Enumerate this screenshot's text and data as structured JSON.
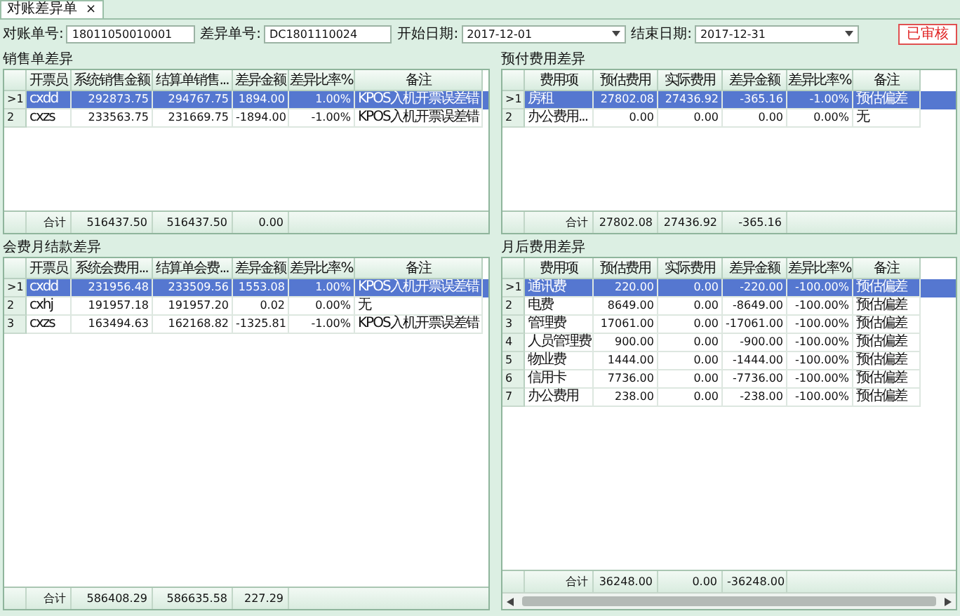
{
  "tab": {
    "label": "对账差异单",
    "close": "×"
  },
  "filters": [
    {
      "label": "对账单号:",
      "value": "18011050010001",
      "kind": "text"
    },
    {
      "label": "差异单号:",
      "value": "DC1801110024",
      "kind": "text"
    },
    {
      "label": "开始日期:",
      "value": "2017-12-01",
      "kind": "date"
    },
    {
      "label": "结束日期:",
      "value": "2017-12-31",
      "kind": "date"
    }
  ],
  "status_button": "已审核",
  "left": [
    {
      "title": "销售单差异",
      "columns": [
        {
          "label": "开票员",
          "kind": "text"
        },
        {
          "label": "系统销售金额",
          "kind": "number"
        },
        {
          "label": "结算单销售...",
          "kind": "number"
        },
        {
          "label": "差异金额",
          "kind": "number"
        },
        {
          "label": "差异比率%",
          "kind": "number"
        },
        {
          "label": "备注",
          "kind": "text"
        }
      ],
      "rows": [
        {
          "header": ">1",
          "selected": true,
          "cells": [
            "cxdd",
            "292873.75",
            "294767.75",
            "1894.00",
            "1.00%",
            "KPOS入机开票误差错"
          ]
        },
        {
          "header": "2",
          "selected": false,
          "cells": [
            "cxzs",
            "233563.75",
            "231669.75",
            "-1894.00",
            "-1.00%",
            "KPOS入机开票误差错"
          ]
        }
      ],
      "total": {
        "label": "合计",
        "values": [
          "516437.50",
          "516437.50",
          "0.00"
        ]
      }
    },
    {
      "title": "会费月结款差异",
      "columns": [
        {
          "label": "开票员",
          "kind": "text"
        },
        {
          "label": "系统会费用...",
          "kind": "number"
        },
        {
          "label": "结算单会费...",
          "kind": "number"
        },
        {
          "label": "差异金额",
          "kind": "number"
        },
        {
          "label": "差异比率%",
          "kind": "number"
        },
        {
          "label": "备注",
          "kind": "text"
        }
      ],
      "rows": [
        {
          "header": ">1",
          "selected": true,
          "cells": [
            "cxdd",
            "231956.48",
            "233509.56",
            "1553.08",
            "1.00%",
            "KPOS入机开票误差错"
          ]
        },
        {
          "header": "2",
          "selected": false,
          "cells": [
            "cxhj",
            "191957.18",
            "191957.20",
            "0.02",
            "0.00%",
            "无"
          ]
        },
        {
          "header": "3",
          "selected": false,
          "cells": [
            "cxzs",
            "163494.63",
            "162168.82",
            "-1325.81",
            "-1.00%",
            "KPOS入机开票误差错"
          ]
        }
      ],
      "total": {
        "label": "合计",
        "values": [
          "586408.29",
          "586635.58",
          "227.29"
        ]
      }
    }
  ],
  "right": [
    {
      "title": "预付费用差异",
      "columns": [
        {
          "label": "费用项",
          "kind": "text"
        },
        {
          "label": "预估费用",
          "kind": "number"
        },
        {
          "label": "实际费用",
          "kind": "number"
        },
        {
          "label": "差异金额",
          "kind": "number"
        },
        {
          "label": "差异比率%",
          "kind": "number"
        },
        {
          "label": "备注",
          "kind": "text"
        }
      ],
      "rows": [
        {
          "header": ">1",
          "selected": true,
          "cells": [
            "房租",
            "27802.08",
            "27436.92",
            "-365.16",
            "-1.00%",
            "预估偏差"
          ]
        },
        {
          "header": "2",
          "selected": false,
          "cells": [
            "办公费用...",
            "0.00",
            "0.00",
            "0.00",
            "0.00%",
            "无"
          ]
        }
      ],
      "total": {
        "label": "合计",
        "values": [
          "27802.08",
          "27436.92",
          "-365.16"
        ]
      }
    },
    {
      "title": "月后费用差异",
      "columns": [
        {
          "label": "费用项",
          "kind": "text"
        },
        {
          "label": "预估费用",
          "kind": "number"
        },
        {
          "label": "实际费用",
          "kind": "number"
        },
        {
          "label": "差异金额",
          "kind": "number"
        },
        {
          "label": "差异比率%",
          "kind": "number"
        },
        {
          "label": "备注",
          "kind": "text"
        }
      ],
      "rows": [
        {
          "header": ">1",
          "selected": true,
          "cells": [
            "通讯费",
            "220.00",
            "0.00",
            "-220.00",
            "-100.00%",
            "预估偏差"
          ]
        },
        {
          "header": "2",
          "selected": false,
          "cells": [
            "电费",
            "8649.00",
            "0.00",
            "-8649.00",
            "-100.00%",
            "预估偏差"
          ]
        },
        {
          "header": "3",
          "selected": false,
          "cells": [
            "管理费",
            "17061.00",
            "0.00",
            "-17061.00",
            "-100.00%",
            "预估偏差"
          ]
        },
        {
          "header": "4",
          "selected": false,
          "cells": [
            "人员管理费",
            "900.00",
            "0.00",
            "-900.00",
            "-100.00%",
            "预估偏差"
          ]
        },
        {
          "header": "5",
          "selected": false,
          "cells": [
            "物业费",
            "1444.00",
            "0.00",
            "-1444.00",
            "-100.00%",
            "预估偏差"
          ]
        },
        {
          "header": "6",
          "selected": false,
          "cells": [
            "信用卡",
            "7736.00",
            "0.00",
            "-7736.00",
            "-100.00%",
            "预估偏差"
          ]
        },
        {
          "header": "7",
          "selected": false,
          "cells": [
            "办公费用",
            "238.00",
            "0.00",
            "-238.00",
            "-100.00%",
            "预估偏差"
          ]
        }
      ],
      "total": {
        "label": "合计",
        "values": [
          "36248.00",
          "0.00",
          "-36248.00"
        ]
      }
    }
  ]
}
